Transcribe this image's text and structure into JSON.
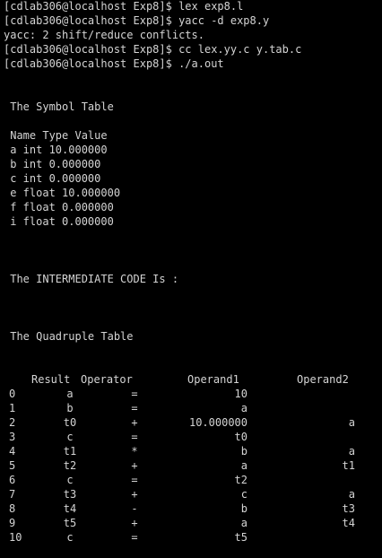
{
  "terminal": {
    "commands": [
      "[cdlab306@localhost Exp8]$ lex exp8.l",
      "[cdlab306@localhost Exp8]$ yacc -d exp8.y",
      "yacc: 2 shift/reduce conflicts.",
      "[cdlab306@localhost Exp8]$ cc lex.yy.c y.tab.c",
      "[cdlab306@localhost Exp8]$ ./a.out"
    ],
    "symbol_table": {
      "title": " The Symbol Table",
      "header": " Name Type Value",
      "rows": [
        " a int 10.000000",
        " b int 0.000000",
        " c int 0.000000",
        " e float 10.000000",
        " f float 0.000000",
        " i float 0.000000"
      ]
    },
    "intermediate_code_title": " The INTERMEDIATE CODE Is :",
    "quadruple_table": {
      "title": " The Quadruple Table",
      "headers": {
        "result": "Result",
        "operator": "Operator",
        "operand1": "Operand1",
        "operand2": "Operand2"
      },
      "rows": [
        {
          "index": "0",
          "result": "a",
          "operator": "=",
          "operand1": "10",
          "operand2": ""
        },
        {
          "index": "1",
          "result": "b",
          "operator": "=",
          "operand1": "a",
          "operand2": ""
        },
        {
          "index": "2",
          "result": "t0",
          "operator": "+",
          "operand1": "10.000000",
          "operand2": "a"
        },
        {
          "index": "3",
          "result": "c",
          "operator": "=",
          "operand1": "t0",
          "operand2": ""
        },
        {
          "index": "4",
          "result": "t1",
          "operator": "*",
          "operand1": "b",
          "operand2": "a"
        },
        {
          "index": "5",
          "result": "t2",
          "operator": "+",
          "operand1": "a",
          "operand2": "t1"
        },
        {
          "index": "6",
          "result": "c",
          "operator": "=",
          "operand1": "t2",
          "operand2": ""
        },
        {
          "index": "7",
          "result": "t3",
          "operator": "+",
          "operand1": "c",
          "operand2": "a"
        },
        {
          "index": "8",
          "result": "t4",
          "operator": "-",
          "operand1": "b",
          "operand2": "t3"
        },
        {
          "index": "9",
          "result": "t5",
          "operator": "+",
          "operand1": "a",
          "operand2": "t4"
        },
        {
          "index": "10",
          "result": "c",
          "operator": "=",
          "operand1": "t5",
          "operand2": ""
        }
      ]
    }
  }
}
